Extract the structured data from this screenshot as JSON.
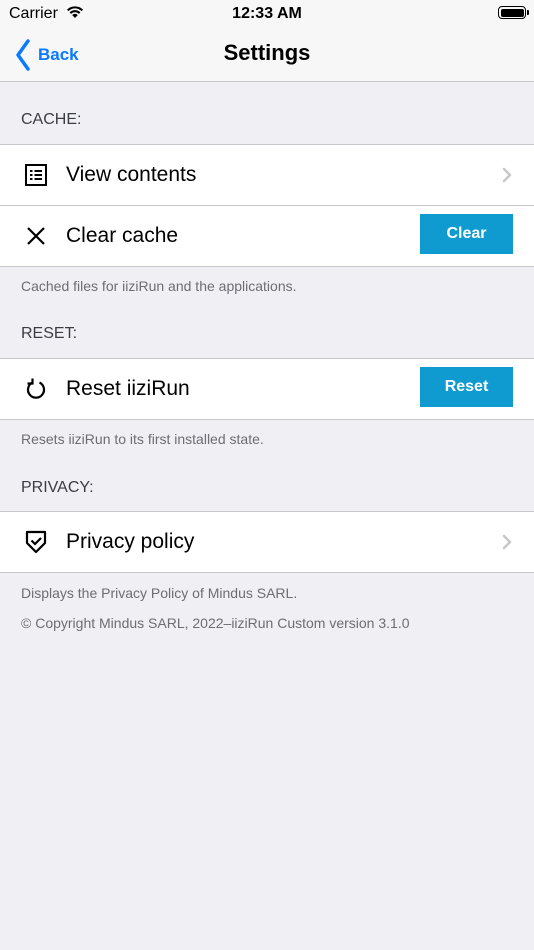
{
  "status": {
    "carrier": "Carrier",
    "time": "12:33 AM"
  },
  "nav": {
    "back_label": "Back",
    "title": "Settings"
  },
  "cache": {
    "header": "CACHE:",
    "view_contents": "View contents",
    "clear_cache": "Clear cache",
    "clear_button": "Clear",
    "footer": "Cached files for iiziRun and the applications."
  },
  "reset": {
    "header": "RESET:",
    "reset_label": "Reset iiziRun",
    "reset_button": "Reset",
    "footer": "Resets iiziRun to its first installed state."
  },
  "privacy": {
    "header": "PRIVACY:",
    "policy_label": "Privacy policy",
    "footer": "Displays the Privacy Policy of Mindus SARL.",
    "copyright": "© Copyright Mindus SARL, 2022–iiziRun Custom version 3.1.0"
  },
  "colors": {
    "accent": "#0a7aff",
    "button": "#0f9bcf",
    "background": "#efeff4"
  },
  "icons": [
    "wifi-icon",
    "battery-icon",
    "back-chevron-icon",
    "list-icon",
    "close-icon",
    "refresh-icon",
    "shield-check-icon",
    "chevron-right-icon"
  ]
}
